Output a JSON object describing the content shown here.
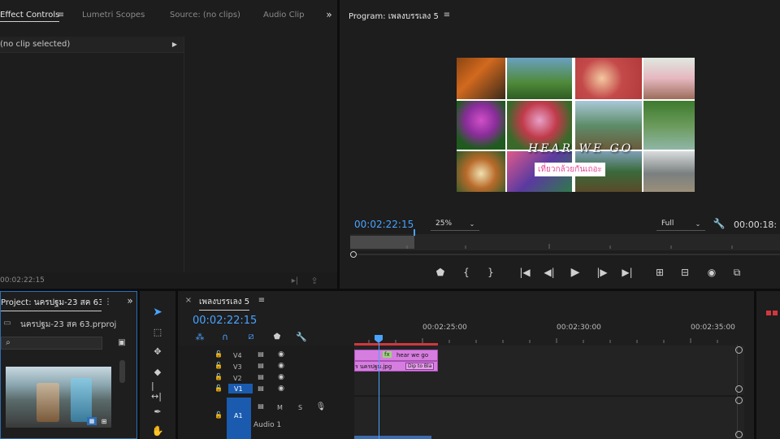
{
  "effect_panel": {
    "tabs": [
      "Effect Controls",
      "Lumetri Scopes",
      "Source: (no clips)",
      "Audio Clip M"
    ],
    "no_clip": "(no clip selected)",
    "timecode": "00:02:22:15"
  },
  "program": {
    "title": "Program: เพลงบรรเลง 5",
    "timecode_left": "00:02:22:15",
    "zoom": "25%",
    "quality": "Full",
    "timecode_right": "00:00:18:",
    "overlay_title": "HEAR WE GO",
    "overlay_sub": "เที่ยวกล้วยกันเถอะ",
    "playhead_fraction": 0.15
  },
  "project": {
    "title": "Project: นครปฐม-23 สค 63",
    "file": "นครปฐม-23 สค 63.prproj",
    "search_placeholder": ""
  },
  "timeline": {
    "seq_tab": "เพลงบรรเลง 5",
    "timecode": "00:02:22:15",
    "ruler": [
      "00:02:25:00",
      "00:02:30:00",
      "00:02:35:00"
    ],
    "tracks_video": [
      "V4",
      "V3",
      "V2",
      "V1"
    ],
    "track_a1": "A1",
    "audio_name": "Audio 1",
    "m": "M",
    "s": "S",
    "clip_title": "hear we go",
    "clip_img": "ร นครปฐม.jpg",
    "clip_dissolve": "Dip to Bla",
    "fx": "fx"
  },
  "colors": {
    "accent": "#2d8ceb",
    "clip_pink": "#d67ee0",
    "timecode_blue": "#4aa3ff"
  }
}
